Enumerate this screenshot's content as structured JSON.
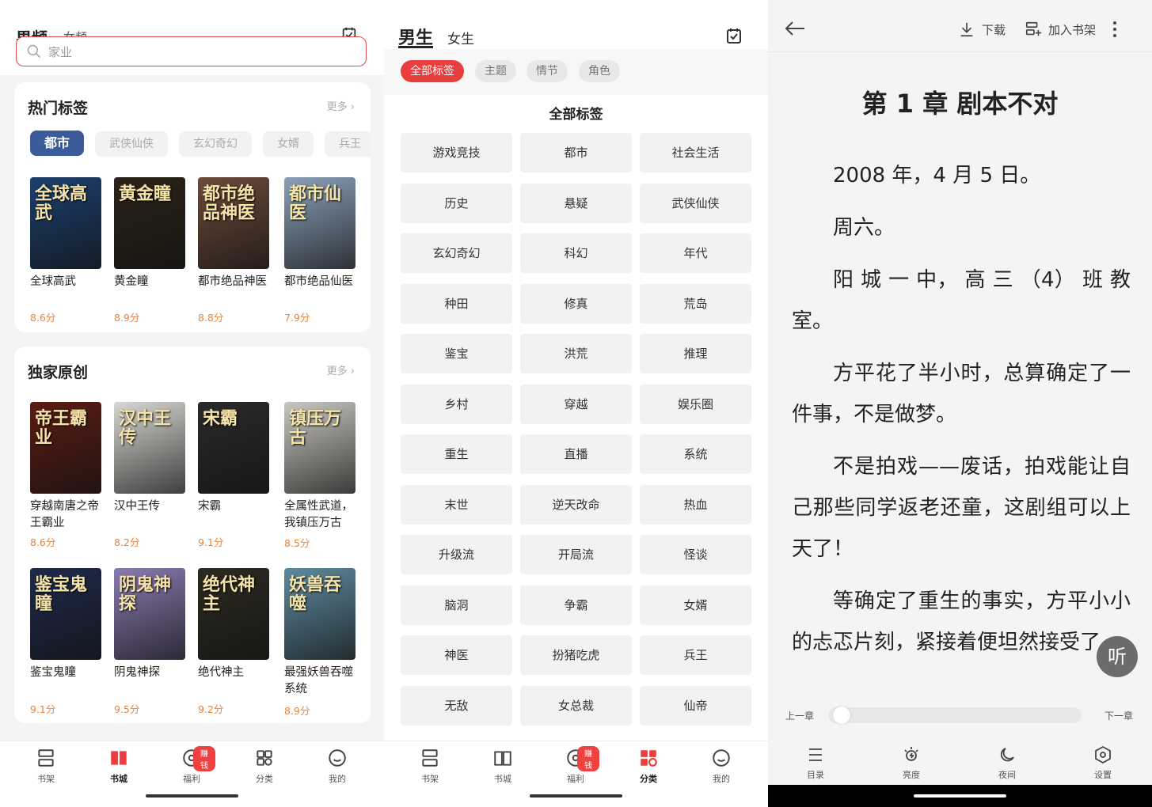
{
  "panel1": {
    "gender_tabs": [
      "男频",
      "女频"
    ],
    "search_placeholder": "家业",
    "hot": {
      "title": "热门标签",
      "more": "更多 ›",
      "chips": [
        "都市",
        "武侠仙侠",
        "玄幻奇幻",
        "女婿",
        "兵王"
      ],
      "books": [
        {
          "title": "全球高武",
          "score": "8.6分",
          "cover_text": "全球高武",
          "cover_color": "#1d3f6e"
        },
        {
          "title": "黄金瞳",
          "score": "8.9分",
          "cover_text": "黄金瞳",
          "cover_color": "#2a2318"
        },
        {
          "title": "都市绝品神医",
          "score": "8.8分",
          "cover_text": "都市绝品神医",
          "cover_color": "#6b4a3a"
        },
        {
          "title": "都市绝品仙医",
          "score": "7.9分",
          "cover_text": "都市仙医",
          "cover_color": "#8aa0b8"
        }
      ]
    },
    "exclusive": {
      "title": "独家原创",
      "more": "更多 ›",
      "books": [
        {
          "title": "穿越南唐之帝王霸业",
          "score": "8.6分",
          "cover_text": "帝王霸业",
          "cover_color": "#5a1c14"
        },
        {
          "title": "汉中王传",
          "score": "8.2分",
          "cover_text": "汉中王传",
          "cover_color": "#d7d7d3"
        },
        {
          "title": "宋霸",
          "score": "9.1分",
          "cover_text": "宋霸",
          "cover_color": "#2a2a2a"
        },
        {
          "title": "全属性武道，我镇压万古",
          "score": "8.5分",
          "cover_text": "镇压万古",
          "cover_color": "#c9c7c1"
        },
        {
          "title": "鉴宝鬼瞳",
          "score": "9.1分",
          "cover_text": "鉴宝鬼瞳",
          "cover_color": "#1f2a4a"
        },
        {
          "title": "阴鬼神探",
          "score": "9.5分",
          "cover_text": "阴鬼神探",
          "cover_color": "#8a7bb0"
        },
        {
          "title": "绝代神主",
          "score": "9.2分",
          "cover_text": "绝代神主",
          "cover_color": "#2c2a20"
        },
        {
          "title": "最强妖兽吞噬系统",
          "score": "8.9分",
          "cover_text": "妖兽吞噬",
          "cover_color": "#5e8a9e"
        }
      ]
    },
    "nav": [
      "书架",
      "书城",
      "福利",
      "分类",
      "我的"
    ],
    "badge": "赚钱"
  },
  "panel2": {
    "tabs": [
      "男生",
      "女生"
    ],
    "filters": [
      "全部标签",
      "主题",
      "情节",
      "角色"
    ],
    "section_title": "全部标签",
    "tags": [
      "游戏竞技",
      "都市",
      "社会生活",
      "历史",
      "悬疑",
      "武侠仙侠",
      "玄幻奇幻",
      "科幻",
      "年代",
      "种田",
      "修真",
      "荒岛",
      "鉴宝",
      "洪荒",
      "推理",
      "乡村",
      "穿越",
      "娱乐圈",
      "重生",
      "直播",
      "系统",
      "末世",
      "逆天改命",
      "热血",
      "升级流",
      "开局流",
      "怪谈",
      "脑洞",
      "争霸",
      "女婿",
      "神医",
      "扮猪吃虎",
      "兵王",
      "无敌",
      "女总裁",
      "仙帝"
    ],
    "nav": [
      "书架",
      "书城",
      "福利",
      "分类",
      "我的"
    ],
    "badge": "赚钱"
  },
  "panel3": {
    "download": "下载",
    "add_shelf": "加入书架",
    "chapter_title": "第 1 章 剧本不对",
    "paragraphs": [
      "2008 年，4 月 5 日。",
      "周六。",
      "阳 城 一 中， 高 三 （4） 班 教室。",
      "方平花了半小时，总算确定了一件事，不是做梦。",
      "不是拍戏——废话，拍戏能让自己那些同学返老还童，这剧组可以上天了！",
      "等确定了重生的事实，方平小小的忐忑片刻，紧接着便坦然接受了。"
    ],
    "listen": "听",
    "prev": "上一章",
    "next": "下一章",
    "progress": 0.02,
    "nav": [
      "目录",
      "亮度",
      "夜间",
      "设置"
    ]
  }
}
